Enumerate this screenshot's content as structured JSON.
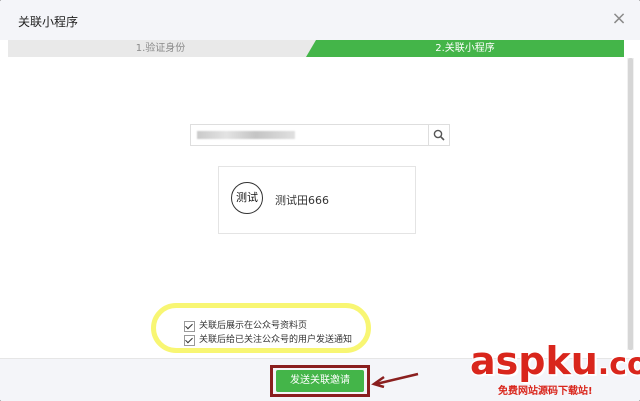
{
  "dialog": {
    "title": "关联小程序",
    "close_icon": "close-icon"
  },
  "steps": [
    {
      "label": "1.验证身份",
      "active": false
    },
    {
      "label": "2.关联小程序",
      "active": true
    }
  ],
  "search": {
    "icon": "search-icon"
  },
  "app_card": {
    "avatar_text": "测试",
    "name": "测试田666"
  },
  "options": [
    {
      "label": "关联后展示在公众号资料页",
      "checked": true
    },
    {
      "label": "关联后给已关注公众号的用户发送通知",
      "checked": true
    }
  ],
  "footer": {
    "send_label": "发送关联邀请"
  },
  "watermark": {
    "main": "aspku",
    "suffix": ".com",
    "sub": "免费网站源码下载站!"
  },
  "colors": {
    "accent": "#44b549",
    "highlight": "#f7f45a",
    "annotation": "#8a1f1f",
    "watermark": "#d9261c"
  }
}
